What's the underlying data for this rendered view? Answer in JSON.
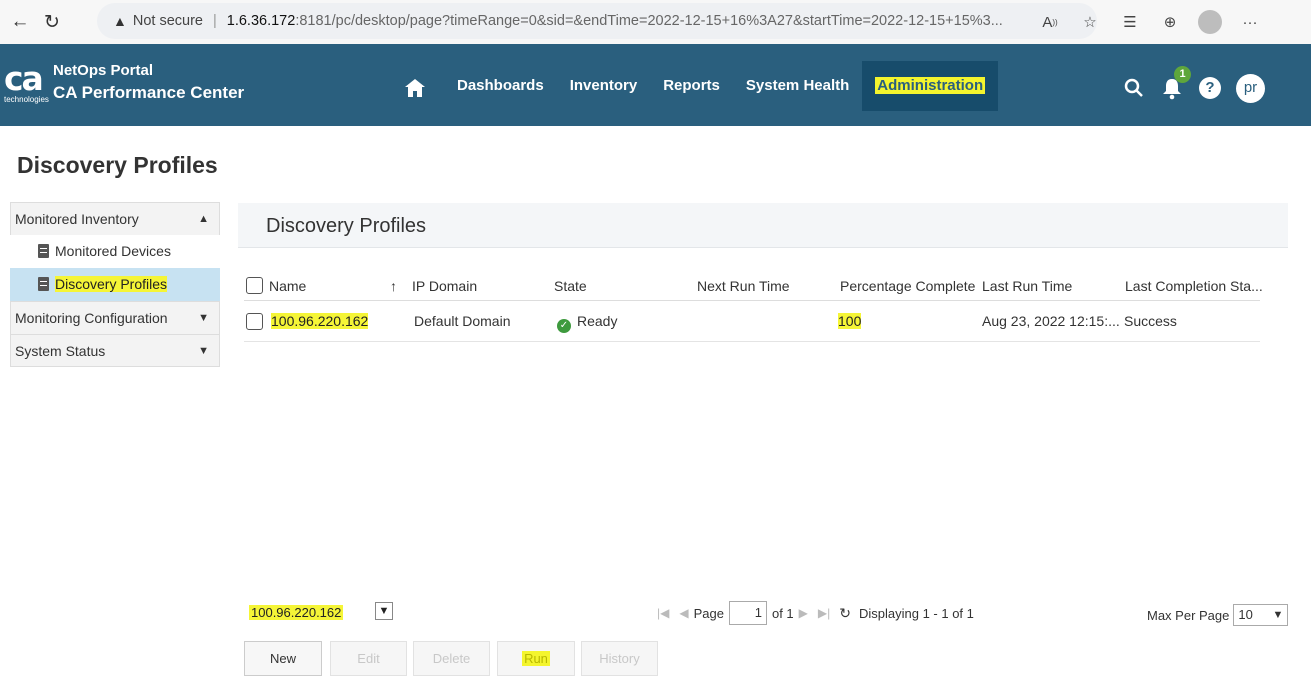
{
  "browser": {
    "security_label": "Not secure",
    "url_host": "1.6.36.172",
    "url_rest": ":8181/pc/desktop/page?timeRange=0&sid=&endTime=2022-12-15+16%3A27&startTime=2022-12-15+15%3...",
    "icons": [
      "back-icon",
      "refresh-icon",
      "read-aloud-icon",
      "favorite-add-icon",
      "favorites-icon",
      "collections-icon",
      "profile-icon",
      "more-icon"
    ],
    "more_label": "···"
  },
  "header": {
    "logo_text": "ca",
    "logo_subtext": "technologies",
    "brand_line1": "NetOps Portal",
    "brand_line2": "CA Performance Center",
    "nav": [
      "Dashboards",
      "Inventory",
      "Reports",
      "System Health",
      "Administration"
    ],
    "active_nav": "Administration",
    "notification_count": "1",
    "help_label": "?",
    "avatar_initials": "pr",
    "colors": {
      "header_bg": "#2a5f7e",
      "active_bg": "#174c6b",
      "highlight": "#f4f52e"
    }
  },
  "page": {
    "title": "Discovery Profiles"
  },
  "sidebar": {
    "sections": [
      {
        "label": "Monitored Inventory",
        "expanded": true,
        "items": [
          {
            "label": "Monitored Devices",
            "selected": false
          },
          {
            "label": "Discovery Profiles",
            "selected": true
          }
        ]
      },
      {
        "label": "Monitoring Configuration",
        "expanded": false,
        "items": []
      },
      {
        "label": "System Status",
        "expanded": false,
        "items": []
      }
    ]
  },
  "panel": {
    "title": "Discovery Profiles"
  },
  "grid": {
    "columns": [
      "Name",
      "IP Domain",
      "State",
      "Next Run Time",
      "Percentage Complete",
      "Last Run Time",
      "Last Completion Sta..."
    ],
    "sort_indicator": "↑",
    "rows": [
      {
        "name": "100.96.220.162",
        "ip_domain": "Default Domain",
        "state": "Ready",
        "next_run_time": "",
        "percentage_complete": "100",
        "last_run_time": "Aug 23, 2022 12:15:...",
        "last_completion_status": "Success"
      }
    ]
  },
  "toolbar": {
    "filter_value": "100.96.220.162",
    "page_label": "Page",
    "page_value": "1",
    "of_label": "of 1",
    "displaying": "Displaying 1 - 1 of 1",
    "max_per_page_label": "Max Per Page",
    "max_per_page_value": "10",
    "buttons": {
      "new": "New",
      "edit": "Edit",
      "delete": "Delete",
      "run": "Run",
      "history": "History"
    }
  }
}
